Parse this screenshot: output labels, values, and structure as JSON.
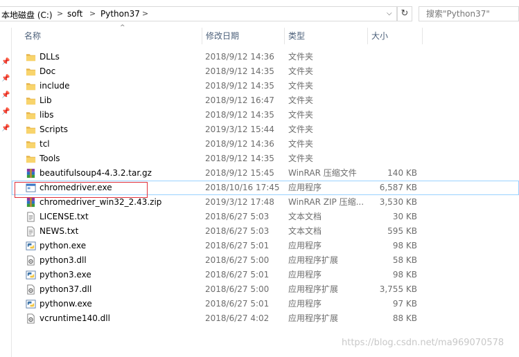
{
  "address": {
    "crumbs": [
      "本地磁盘 (C:)",
      "soft",
      "Python37"
    ],
    "separator": ">",
    "dropdown_glyph": "⌵",
    "refresh_glyph": "↻"
  },
  "search": {
    "placeholder": "搜索\"Python37\""
  },
  "columns": {
    "name": "名称",
    "date": "修改日期",
    "type": "类型",
    "size": "大小",
    "sort_glyph": "^"
  },
  "pin_glyph": "📌",
  "files": [
    {
      "name": "DLLs",
      "date": "2018/9/12 14:36",
      "type": "文件夹",
      "size": "",
      "icon": "folder-icon"
    },
    {
      "name": "Doc",
      "date": "2018/9/12 14:35",
      "type": "文件夹",
      "size": "",
      "icon": "folder-icon"
    },
    {
      "name": "include",
      "date": "2018/9/12 14:35",
      "type": "文件夹",
      "size": "",
      "icon": "folder-icon"
    },
    {
      "name": "Lib",
      "date": "2018/9/12 16:47",
      "type": "文件夹",
      "size": "",
      "icon": "folder-icon"
    },
    {
      "name": "libs",
      "date": "2018/9/12 14:35",
      "type": "文件夹",
      "size": "",
      "icon": "folder-icon"
    },
    {
      "name": "Scripts",
      "date": "2019/3/12 15:44",
      "type": "文件夹",
      "size": "",
      "icon": "folder-icon"
    },
    {
      "name": "tcl",
      "date": "2018/9/12 14:36",
      "type": "文件夹",
      "size": "",
      "icon": "folder-icon"
    },
    {
      "name": "Tools",
      "date": "2018/9/12 14:35",
      "type": "文件夹",
      "size": "",
      "icon": "folder-icon"
    },
    {
      "name": "beautifulsoup4-4.3.2.tar.gz",
      "date": "2018/9/12 15:45",
      "type": "WinRAR 压缩文件",
      "size": "140 KB",
      "icon": "winrar-archive-icon"
    },
    {
      "name": "chromedriver.exe",
      "date": "2018/10/16 17:45",
      "type": "应用程序",
      "size": "6,587 KB",
      "icon": "application-exe-icon",
      "selected": true
    },
    {
      "name": "chromedriver_win32_2.43.zip",
      "date": "2019/3/12 17:48",
      "type": "WinRAR ZIP 压缩...",
      "size": "3,530 KB",
      "icon": "winrar-archive-icon"
    },
    {
      "name": "LICENSE.txt",
      "date": "2018/6/27 5:03",
      "type": "文本文档",
      "size": "30 KB",
      "icon": "text-file-icon"
    },
    {
      "name": "NEWS.txt",
      "date": "2018/6/27 5:03",
      "type": "文本文档",
      "size": "595 KB",
      "icon": "text-file-icon"
    },
    {
      "name": "python.exe",
      "date": "2018/6/27 5:01",
      "type": "应用程序",
      "size": "98 KB",
      "icon": "python-exe-icon"
    },
    {
      "name": "python3.dll",
      "date": "2018/6/27 5:00",
      "type": "应用程序扩展",
      "size": "58 KB",
      "icon": "dll-file-icon"
    },
    {
      "name": "python3.exe",
      "date": "2018/6/27 5:01",
      "type": "应用程序",
      "size": "98 KB",
      "icon": "python-exe-icon"
    },
    {
      "name": "python37.dll",
      "date": "2018/6/27 5:00",
      "type": "应用程序扩展",
      "size": "3,755 KB",
      "icon": "dll-file-icon"
    },
    {
      "name": "pythonw.exe",
      "date": "2018/6/27 5:01",
      "type": "应用程序",
      "size": "97 KB",
      "icon": "python-exe-icon"
    },
    {
      "name": "vcruntime140.dll",
      "date": "2018/6/27 4:02",
      "type": "应用程序扩展",
      "size": "88 KB",
      "icon": "dll-file-icon"
    }
  ],
  "watermark": "https://blog.csdn.net/ma969070578"
}
